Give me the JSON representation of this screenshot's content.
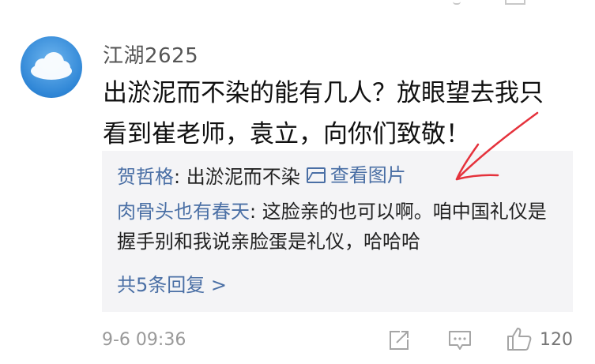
{
  "comment": {
    "username": "江湖2625",
    "text": "出淤泥而不染的能有几人？放眼望去我只看到崔老师，袁立，向你们致敬！",
    "timestamp": "9-6 09:36",
    "likes": "120"
  },
  "replies": [
    {
      "author": "贺哲格",
      "separator": ": ",
      "text": "出淤泥而不染",
      "view_picture_label": "查看图片"
    },
    {
      "author": "肉骨头也有春天",
      "separator": ": ",
      "text": "这脸亲的也可以啊。咱中国礼仪是握手别和我说亲脸蛋是礼仪，哈哈哈"
    }
  ],
  "more_replies_label": "共5条回复 >",
  "icons": {
    "avatar": "cloud-avatar",
    "view_picture": "image-icon",
    "share": "share-icon",
    "comment": "comment-icon",
    "like": "thumbs-up-icon"
  },
  "colors": {
    "link": "#4a6fa5",
    "reply_background": "#f4f4f6",
    "annotation_arrow": "#e5323c"
  }
}
